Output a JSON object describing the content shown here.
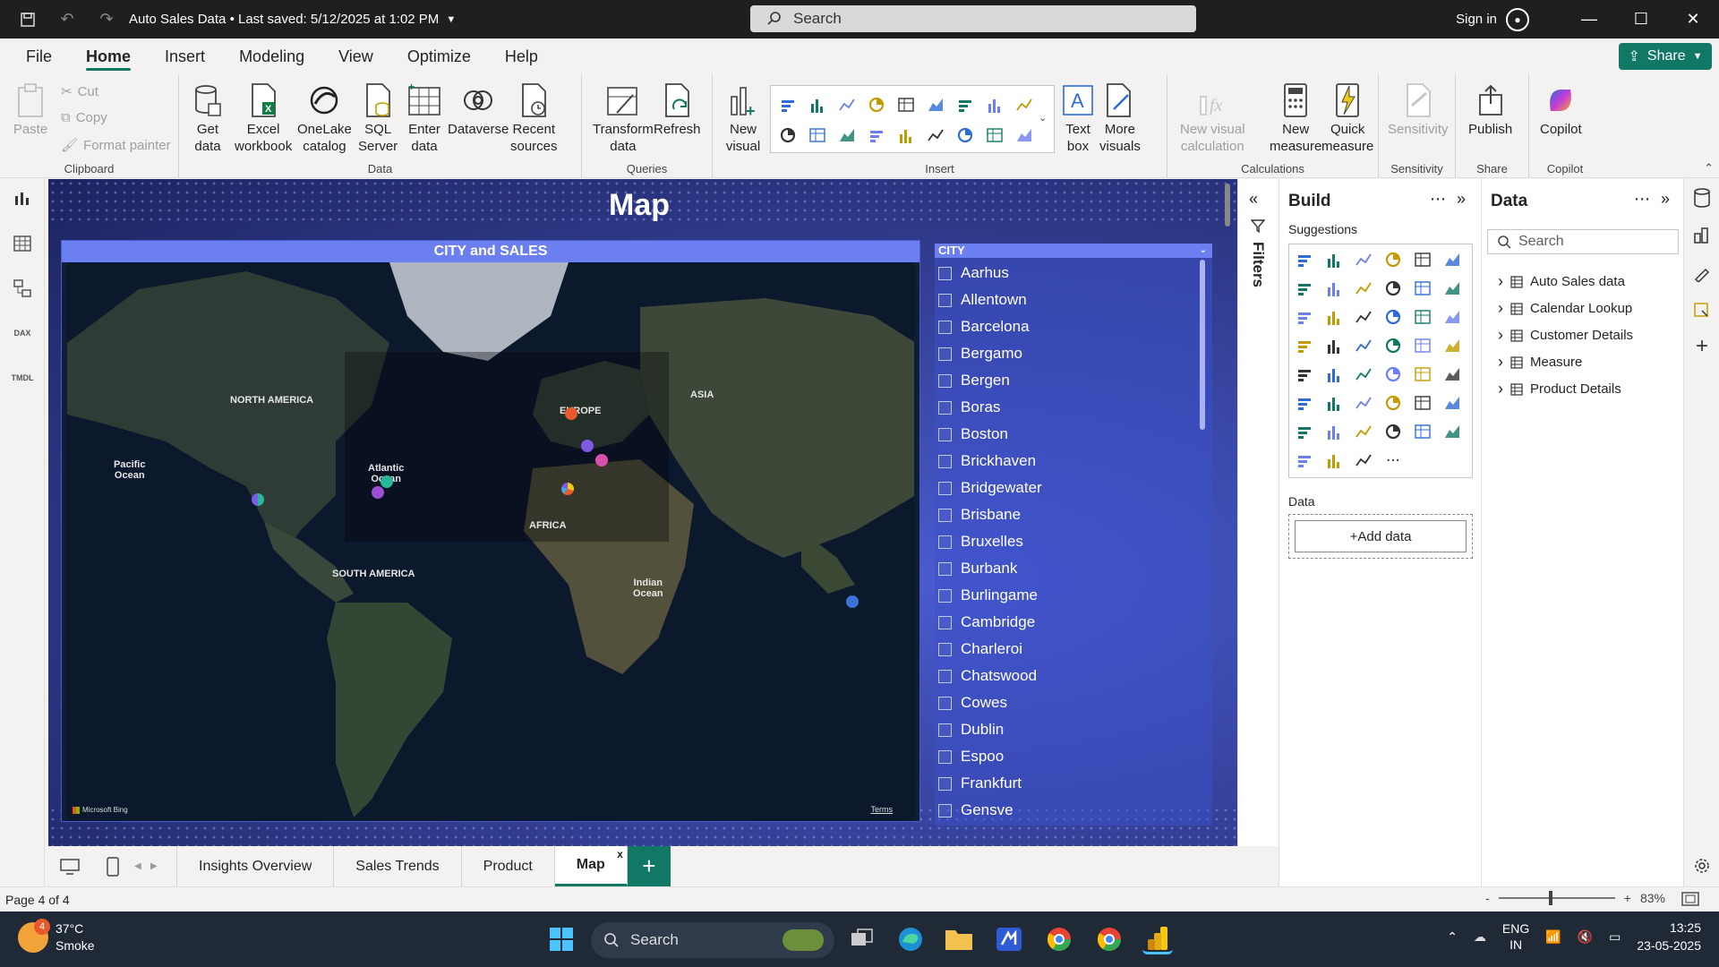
{
  "titlebar": {
    "title": "Auto Sales Data • Last saved: 5/12/2025 at 1:02 PM",
    "search_placeholder": "Search",
    "signin": "Sign in"
  },
  "menu": {
    "items": [
      "File",
      "Home",
      "Insert",
      "Modeling",
      "View",
      "Optimize",
      "Help"
    ],
    "active": "Home",
    "share": "Share"
  },
  "ribbon": {
    "clipboard": {
      "paste": "Paste",
      "cut": "Cut",
      "copy": "Copy",
      "format_painter": "Format painter",
      "label": "Clipboard"
    },
    "data": {
      "get_data": "Get\ndata",
      "excel": "Excel\nworkbook",
      "onelake": "OneLake\ncatalog",
      "sql": "SQL\nServer",
      "enter": "Enter\ndata",
      "dataverse": "Dataverse",
      "recent": "Recent\nsources",
      "label": "Data"
    },
    "queries": {
      "transform": "Transform\ndata",
      "refresh": "Refresh",
      "label": "Queries"
    },
    "insert": {
      "new_visual": "New\nvisual",
      "text_box": "Text\nbox",
      "more_visuals": "More\nvisuals",
      "label": "Insert"
    },
    "calculations": {
      "new_visual_calc": "New visual\ncalculation",
      "new_measure": "New\nmeasure",
      "quick_measure": "Quick\nmeasure",
      "label": "Calculations"
    },
    "sensitivity": {
      "sensitivity": "Sensitivity",
      "label": "Sensitivity"
    },
    "share": {
      "publish": "Publish",
      "label": "Share"
    },
    "copilot": {
      "copilot": "Copilot",
      "label": "Copilot"
    }
  },
  "canvas": {
    "page_title": "Map",
    "map": {
      "header": "CITY and SALES",
      "labels": {
        "north_america": "NORTH AMERICA",
        "europe": "EUROPE",
        "asia": "ASIA",
        "pacific": "Pacific\nOcean",
        "atlantic": "Atlantic\nOcean",
        "africa": "AFRICA",
        "south_america": "SOUTH AMERICA",
        "indian": "Indian\nOcean"
      },
      "provider": "Microsoft Bing",
      "terms": "Terms"
    },
    "slicer": {
      "header": "CITY",
      "items": [
        "Aarhus",
        "Allentown",
        "Barcelona",
        "Bergamo",
        "Bergen",
        "Boras",
        "Boston",
        "Brickhaven",
        "Bridgewater",
        "Brisbane",
        "Bruxelles",
        "Burbank",
        "Burlingame",
        "Cambridge",
        "Charleroi",
        "Chatswood",
        "Cowes",
        "Dublin",
        "Espoo",
        "Frankfurt",
        "Gensve"
      ]
    }
  },
  "pages": {
    "tabs": [
      "Insights Overview",
      "Sales Trends",
      "Product",
      "Map"
    ],
    "active": "Map",
    "close": "x",
    "add": "+"
  },
  "filters": {
    "label": "Filters"
  },
  "build": {
    "title": "Build",
    "suggestions": "Suggestions",
    "data_label": "Data",
    "add_data": "+Add data"
  },
  "datapane": {
    "title": "Data",
    "search_placeholder": "Search",
    "tables": [
      "Auto Sales data",
      "Calendar Lookup",
      "Customer Details",
      "Measure",
      "Product Details"
    ]
  },
  "status": {
    "page": "Page 4 of 4",
    "zoom": "83%"
  },
  "taskbar": {
    "temp": "37°C",
    "weather": "Smoke",
    "badge": "4",
    "search": "Search",
    "lang1": "ENG",
    "lang2": "IN",
    "time": "13:25",
    "date": "23-05-2025"
  },
  "colors": {
    "accent": "#117865",
    "canvas": "#3a47a6",
    "header_bar": "#6b7ff0"
  }
}
